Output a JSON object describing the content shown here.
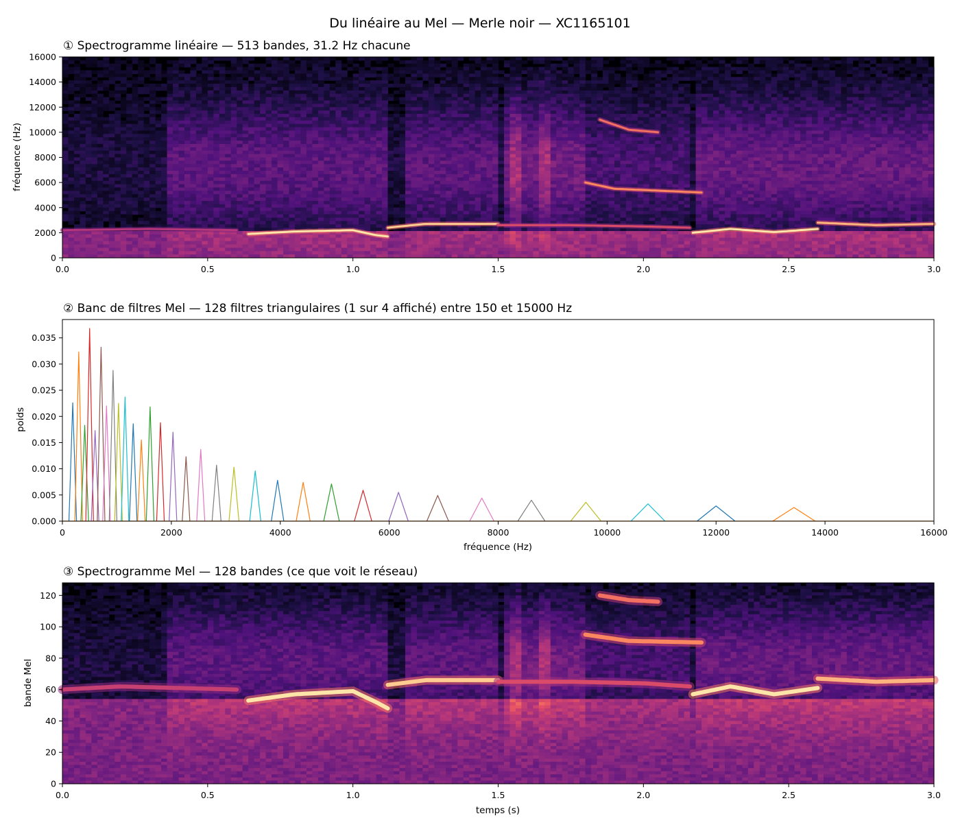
{
  "figure_title": "Du linéaire au Mel — Merle noir — XC1165101",
  "chart_data": [
    {
      "type": "heatmap",
      "title": "① Spectrogramme linéaire — 513 bandes, 31.2 Hz chacune",
      "xlabel": "",
      "ylabel": "fréquence (Hz)",
      "xlim": [
        0,
        3.0
      ],
      "ylim": [
        0,
        16000
      ],
      "xticks": [
        "0.0",
        "0.5",
        "1.0",
        "1.5",
        "2.0",
        "2.5",
        "3.0"
      ],
      "yticks": [
        "0",
        "2000",
        "4000",
        "6000",
        "8000",
        "10000",
        "12000",
        "14000",
        "16000"
      ],
      "colormap": "magma",
      "grid": false,
      "ridges": [
        {
          "t": [
            0.0,
            0.3,
            0.6
          ],
          "f": [
            2200,
            2300,
            2200
          ],
          "strength": 0.5
        },
        {
          "t": [
            0.64,
            0.8,
            1.0,
            1.08,
            1.12
          ],
          "f": [
            1900,
            2100,
            2200,
            1800,
            1700
          ],
          "strength": 0.95
        },
        {
          "t": [
            1.12,
            1.25,
            1.5
          ],
          "f": [
            2400,
            2700,
            2700
          ],
          "strength": 0.9
        },
        {
          "t": [
            1.5,
            1.75,
            2.0,
            2.16
          ],
          "f": [
            2600,
            2600,
            2500,
            2400
          ],
          "strength": 0.6
        },
        {
          "t": [
            2.17,
            2.3,
            2.45,
            2.6
          ],
          "f": [
            2000,
            2300,
            2050,
            2300
          ],
          "strength": 0.95
        },
        {
          "t": [
            2.6,
            2.8,
            3.0
          ],
          "f": [
            2800,
            2600,
            2700
          ],
          "strength": 0.85
        },
        {
          "t": [
            1.8,
            1.9,
            2.2
          ],
          "f": [
            6000,
            5500,
            5200
          ],
          "strength": 0.75
        },
        {
          "t": [
            1.85,
            1.95,
            2.05
          ],
          "f": [
            11000,
            10200,
            10000
          ],
          "strength": 0.7
        }
      ]
    },
    {
      "type": "line",
      "title": "② Banc de filtres Mel — 128 filtres triangulaires (1 sur 4 affiché) entre 150 et 15000 Hz",
      "xlabel": "fréquence (Hz)",
      "ylabel": "poids",
      "xlim": [
        0,
        16000
      ],
      "ylim": [
        0,
        0.0385
      ],
      "xticks": [
        "0",
        "2000",
        "4000",
        "6000",
        "8000",
        "10000",
        "12000",
        "14000",
        "16000"
      ],
      "yticks": [
        "0.000",
        "0.005",
        "0.010",
        "0.015",
        "0.020",
        "0.025",
        "0.030",
        "0.035"
      ],
      "grid": false,
      "palette": [
        "#1f77b4",
        "#ff7f0e",
        "#2ca02c",
        "#d62728",
        "#9467bd",
        "#8c564b",
        "#e377c2",
        "#7f7f7f",
        "#bcbd22",
        "#17becf"
      ],
      "series": [
        {
          "center": 190,
          "peak": 0.0226
        },
        {
          "center": 300,
          "peak": 0.0323
        },
        {
          "center": 410,
          "peak": 0.0183
        },
        {
          "center": 500,
          "peak": 0.0368
        },
        {
          "center": 600,
          "peak": 0.0173
        },
        {
          "center": 710,
          "peak": 0.0332
        },
        {
          "center": 810,
          "peak": 0.022
        },
        {
          "center": 930,
          "peak": 0.0288
        },
        {
          "center": 1030,
          "peak": 0.0225
        },
        {
          "center": 1150,
          "peak": 0.0237
        },
        {
          "center": 1300,
          "peak": 0.0186
        },
        {
          "center": 1450,
          "peak": 0.0155
        },
        {
          "center": 1610,
          "peak": 0.0218
        },
        {
          "center": 1800,
          "peak": 0.0188
        },
        {
          "center": 2030,
          "peak": 0.017
        },
        {
          "center": 2270,
          "peak": 0.0123
        },
        {
          "center": 2540,
          "peak": 0.0137
        },
        {
          "center": 2830,
          "peak": 0.0107
        },
        {
          "center": 3150,
          "peak": 0.0103
        },
        {
          "center": 3540,
          "peak": 0.0096
        },
        {
          "center": 3950,
          "peak": 0.0078
        },
        {
          "center": 4420,
          "peak": 0.0074
        },
        {
          "center": 4940,
          "peak": 0.0071
        },
        {
          "center": 5520,
          "peak": 0.0059
        },
        {
          "center": 6170,
          "peak": 0.0055
        },
        {
          "center": 6890,
          "peak": 0.0049
        },
        {
          "center": 7700,
          "peak": 0.0044
        },
        {
          "center": 8610,
          "peak": 0.004
        },
        {
          "center": 9610,
          "peak": 0.0036
        },
        {
          "center": 10750,
          "peak": 0.0033
        },
        {
          "center": 12000,
          "peak": 0.0029
        },
        {
          "center": 13430,
          "peak": 0.0026
        }
      ]
    },
    {
      "type": "heatmap",
      "title": "③ Spectrogramme Mel — 128 bandes (ce que voit le réseau)",
      "xlabel": "temps (s)",
      "ylabel": "bande Mel",
      "xlim": [
        0,
        3.0
      ],
      "ylim": [
        0,
        128
      ],
      "xticks": [
        "0.0",
        "0.5",
        "1.0",
        "1.5",
        "2.0",
        "2.5",
        "3.0"
      ],
      "yticks": [
        "0",
        "20",
        "40",
        "60",
        "80",
        "100",
        "120"
      ],
      "colormap": "magma",
      "grid": false,
      "ridges": [
        {
          "t": [
            0.0,
            0.2,
            0.6
          ],
          "m": [
            60,
            62,
            60
          ],
          "strength": 0.55
        },
        {
          "t": [
            0.64,
            0.8,
            1.0,
            1.08,
            1.12
          ],
          "m": [
            53,
            57,
            59,
            52,
            48
          ],
          "strength": 0.95
        },
        {
          "t": [
            1.12,
            1.25,
            1.5
          ],
          "m": [
            63,
            66,
            66
          ],
          "strength": 0.9
        },
        {
          "t": [
            1.5,
            1.75,
            2.0,
            2.16
          ],
          "m": [
            65,
            65,
            64,
            62
          ],
          "strength": 0.6
        },
        {
          "t": [
            2.17,
            2.3,
            2.45,
            2.6
          ],
          "m": [
            57,
            62,
            57,
            61
          ],
          "strength": 0.95
        },
        {
          "t": [
            2.6,
            2.8,
            3.0
          ],
          "m": [
            67,
            65,
            66
          ],
          "strength": 0.85
        },
        {
          "t": [
            1.8,
            1.95,
            2.2
          ],
          "m": [
            95,
            91,
            90
          ],
          "strength": 0.75
        },
        {
          "t": [
            1.85,
            1.95,
            2.05
          ],
          "m": [
            120,
            117,
            116
          ],
          "strength": 0.7
        }
      ]
    }
  ]
}
